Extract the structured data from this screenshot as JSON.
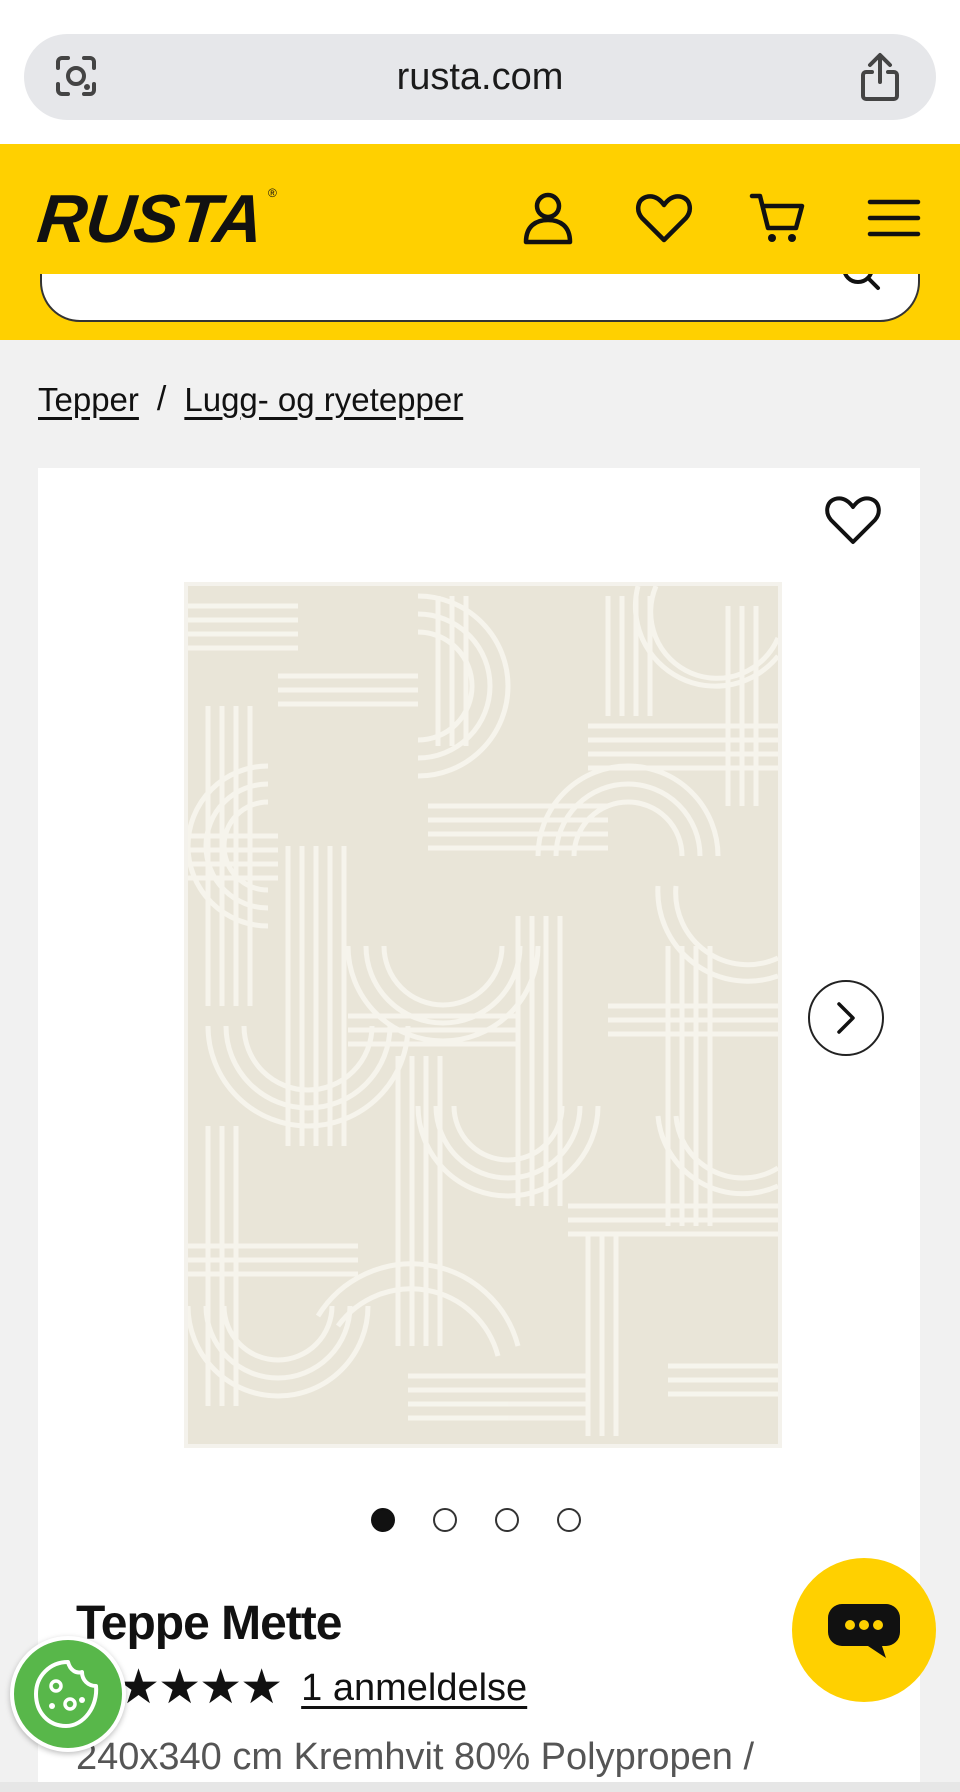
{
  "browser": {
    "url": "rusta.com",
    "icons": {
      "left": "lens-icon",
      "right": "share-icon"
    }
  },
  "header": {
    "logo": "RUSTA",
    "logo_mark": "®",
    "brand_color": "#ffd000",
    "icons": [
      "account-icon",
      "heart-icon",
      "cart-icon",
      "menu-icon"
    ]
  },
  "breadcrumb": {
    "items": [
      "Tepper",
      "Lugg- og ryetepper"
    ],
    "separator": "/"
  },
  "product": {
    "title": "Teppe Mette",
    "rating": 5,
    "stars": "★★★★★",
    "review_link": "1 anmeldelse",
    "description": "240x340 cm Kremhvit 80% Polypropen /",
    "gallery": {
      "image_count": 4,
      "active_index": 0
    },
    "rug_color": "#e9e5d8"
  },
  "widgets": {
    "chat_color": "#ffd000",
    "cookie_color": "#58b74a"
  }
}
